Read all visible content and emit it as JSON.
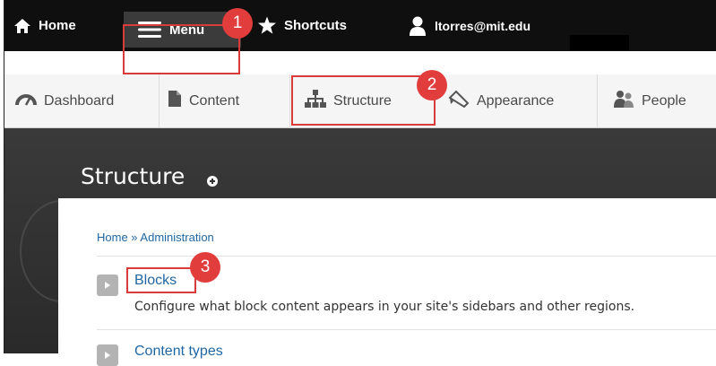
{
  "toolbar": {
    "home_label": "Home",
    "menu_label": "Menu",
    "shortcuts_label": "Shortcuts",
    "user_label": "ltorres@mit.edu"
  },
  "tray": {
    "items": [
      {
        "label": "Dashboard",
        "icon": "dashboard-icon"
      },
      {
        "label": "Content",
        "icon": "document-icon"
      },
      {
        "label": "Structure",
        "icon": "sitemap-icon"
      },
      {
        "label": "Appearance",
        "icon": "paintbrush-icon"
      },
      {
        "label": "People",
        "icon": "people-icon"
      }
    ]
  },
  "page": {
    "title": "Structure",
    "breadcrumb": "Home » Administration",
    "items": [
      {
        "title": "Blocks",
        "description": "Configure what block content appears in your site's sidebars and other regions."
      },
      {
        "title": "Content types",
        "description": ""
      }
    ]
  },
  "steps": [
    "1",
    "2",
    "3"
  ],
  "colors": {
    "highlight": "#d93b3b",
    "badge": "#e23d3d",
    "link": "#1f67a4",
    "toolbar": "#0f0f0f"
  }
}
